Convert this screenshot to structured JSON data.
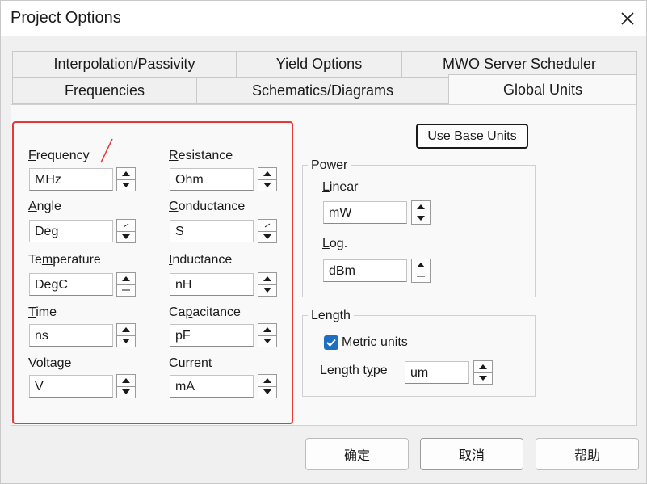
{
  "window": {
    "title": "Project Options"
  },
  "tabs": {
    "row1": [
      "Interpolation/Passivity",
      "Yield Options",
      "MWO Server Scheduler"
    ],
    "row2": [
      "Frequencies",
      "Schematics/Diagrams",
      "Global Units"
    ],
    "active": "Global Units"
  },
  "units": {
    "frequency": {
      "label_pre": "",
      "label_u": "F",
      "label_post": "requency",
      "value": "MHz"
    },
    "angle": {
      "label_pre": "",
      "label_u": "A",
      "label_post": "ngle",
      "value": "Deg"
    },
    "temperature": {
      "label_pre": "Te",
      "label_u": "m",
      "label_post": "perature",
      "value": "DegC"
    },
    "time": {
      "label_pre": "",
      "label_u": "T",
      "label_post": "ime",
      "value": "ns"
    },
    "voltage": {
      "label_pre": "",
      "label_u": "V",
      "label_post": "oltage",
      "value": "V"
    },
    "resistance": {
      "label_pre": "",
      "label_u": "R",
      "label_post": "esistance",
      "value": "Ohm"
    },
    "conductance": {
      "label_pre": "",
      "label_u": "C",
      "label_post": "onductance",
      "value": "S"
    },
    "inductance": {
      "label_pre": "",
      "label_u": "I",
      "label_post": "nductance",
      "value": "nH"
    },
    "capacitance": {
      "label_pre": "Ca",
      "label_u": "p",
      "label_post": "acitance",
      "value": "pF"
    },
    "current": {
      "label_pre": "",
      "label_u": "C",
      "label_post": "urrent",
      "value": "mA"
    }
  },
  "base_units_button": "Use Base Units",
  "power": {
    "group_label": "Power",
    "linear_label_u": "L",
    "linear_label_post": "inear",
    "linear_value": "mW",
    "log_label_u": "L",
    "log_label_post": "og.",
    "log_value": "dBm"
  },
  "length": {
    "group_label": "Length",
    "metric_label_u": "M",
    "metric_label_post": "etric units",
    "metric_checked": true,
    "type_label_pre": "Length t",
    "type_label_u": "y",
    "type_label_post": "pe",
    "type_value": "um"
  },
  "footer": {
    "ok": "确定",
    "cancel": "取消",
    "help": "帮助"
  },
  "colors": {
    "annotation": "#e53935",
    "checkbox": "#1f6fc0"
  }
}
